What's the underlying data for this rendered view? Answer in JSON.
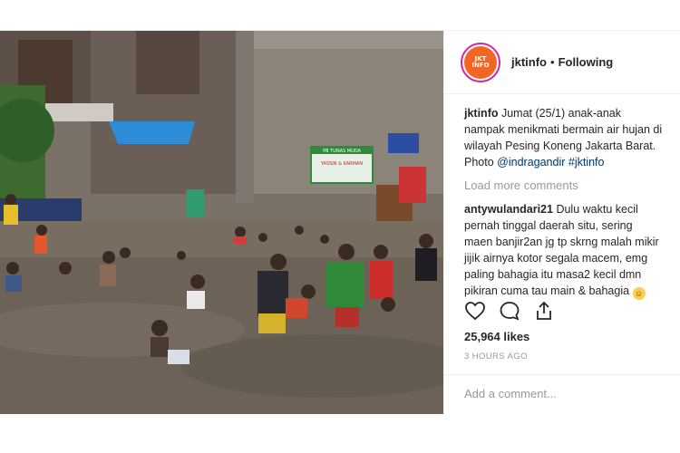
{
  "post": {
    "image_description_alt": "",
    "banner_text_1": "PB TUNAS MUDA",
    "banner_text_2": "YASSIN & KARMAN"
  },
  "header": {
    "username": "jktinfo",
    "separator": "•",
    "follow_label": "Following",
    "avatar_text_1": "JKT",
    "avatar_text_2": "INFO"
  },
  "caption": {
    "username": "jktinfo",
    "text": "Jumat (25/1) anak-anak nampak menikmati bermain air hujan di wilayah Pesing Koneng Jakarta Barat. Photo",
    "mention": "@indragandir",
    "hashtag": "#jktinfo"
  },
  "load_more_label": "Load more comments",
  "comment": {
    "username": "antywulandari21",
    "text": "Dulu waktu kecil pernah tinggal daerah situ, sering maen banjir2an jg tp skrng malah mikir jijik airnya kotor segala macem, emg paling bahagia itu masa2 kecil dmn pikiran cuma tau main & bahagia",
    "emoji": "☺"
  },
  "actions": {
    "like_icon": "heart-icon",
    "comment_icon": "speech-bubble-icon",
    "share_icon": "share-icon"
  },
  "likes_text": "25,964 likes",
  "time_text": "3 HOURS AGO",
  "add_comment_placeholder": "Add a comment..."
}
